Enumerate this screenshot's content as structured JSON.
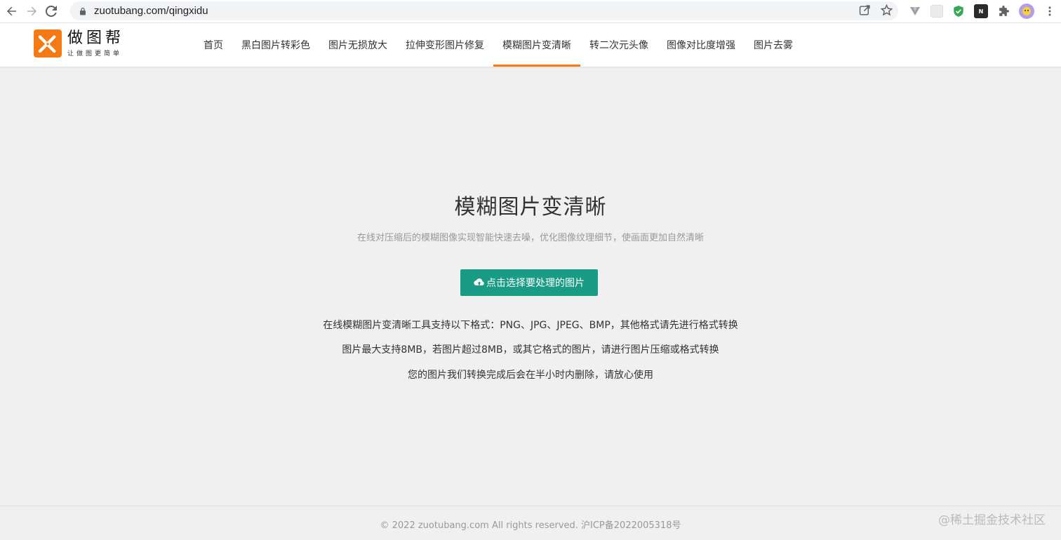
{
  "browser": {
    "url": "zuotubang.com/qingxidu"
  },
  "site": {
    "logo_title": "做图帮",
    "logo_subtitle": "让做图更简单",
    "nav": [
      {
        "label": "首页"
      },
      {
        "label": "黑白图片转彩色"
      },
      {
        "label": "图片无损放大"
      },
      {
        "label": "拉伸变形图片修复"
      },
      {
        "label": "模糊图片变清晰"
      },
      {
        "label": "转二次元头像"
      },
      {
        "label": "图像对比度增强"
      },
      {
        "label": "图片去雾"
      }
    ],
    "active_nav": "模糊图片变清晰",
    "accent_color": "#f57a14"
  },
  "main": {
    "title": "模糊图片变清晰",
    "subtitle": "在线对压缩后的模糊图像实现智能快速去噪，优化图像纹理细节，使画面更加自然清晰",
    "upload_label": "点击选择要处理的图片",
    "button_color": "#1a9b86",
    "info": [
      "在线模糊图片变清晰工具支持以下格式：PNG、JPG、JPEG、BMP，其他格式请先进行格式转换",
      "图片最大支持8MB，若图片超过8MB，或其它格式的图片，请进行图片压缩或格式转换",
      "您的图片我们转换完成后会在半小时内删除，请放心使用"
    ]
  },
  "footer": {
    "copyright": "© 2022 zuotubang.com All rights reserved. 沪ICP备2022005318号",
    "watermark": "@稀土掘金技术社区"
  }
}
